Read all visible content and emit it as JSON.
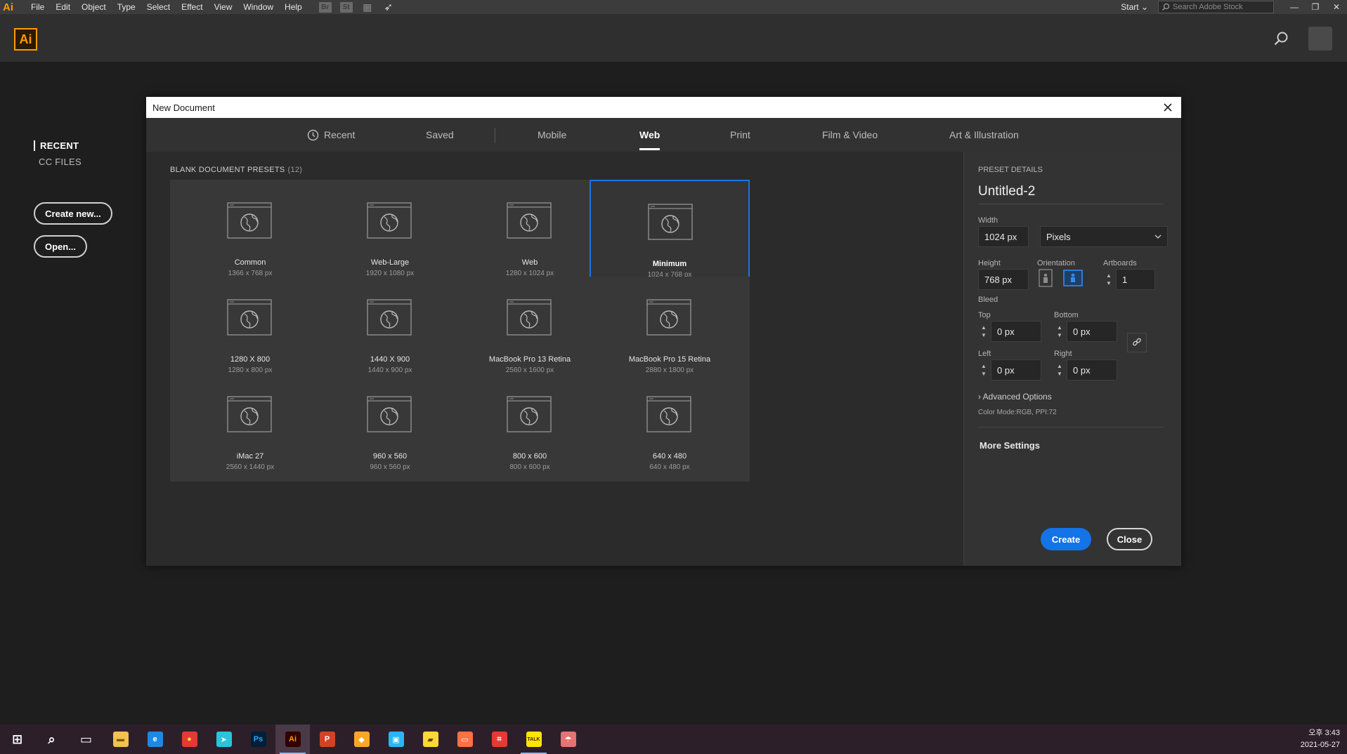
{
  "menubar": {
    "app_mark": "Ai",
    "items": [
      "File",
      "Edit",
      "Object",
      "Type",
      "Select",
      "Effect",
      "View",
      "Window",
      "Help"
    ],
    "toolbar_icons": [
      {
        "name": "bridge-icon",
        "glyph": "Br"
      },
      {
        "name": "stock-icon",
        "glyph": "St"
      },
      {
        "name": "arrange-documents-icon",
        "glyph": "▦"
      },
      {
        "name": "gpu-performance-icon",
        "glyph": "➶"
      }
    ],
    "workspace": "Start",
    "stock_search_placeholder": "Search Adobe Stock"
  },
  "header": {
    "logo": "Ai"
  },
  "start_panel": {
    "nav": [
      "RECENT",
      "CC FILES"
    ],
    "create_button": "Create new...",
    "open_button": "Open..."
  },
  "dialog": {
    "title": "New Document",
    "tabs": [
      "Recent",
      "Saved",
      "Mobile",
      "Web",
      "Print",
      "Film & Video",
      "Art & Illustration"
    ],
    "active_tab": "Web",
    "presets_heading": "BLANK DOCUMENT PRESETS",
    "presets_count": "(12)",
    "presets": [
      {
        "name": "Common",
        "size": "1366 x 768 px"
      },
      {
        "name": "Web-Large",
        "size": "1920 x 1080 px"
      },
      {
        "name": "Web",
        "size": "1280 x 1024 px"
      },
      {
        "name": "Minimum",
        "size": "1024 x 768 px"
      },
      {
        "name": "1280 X 800",
        "size": "1280 x 800 px"
      },
      {
        "name": "1440 X 900",
        "size": "1440 x 900 px"
      },
      {
        "name": "MacBook Pro 13 Retina",
        "size": "2560 x 1600 px"
      },
      {
        "name": "MacBook Pro 15 Retina",
        "size": "2880 x 1800 px"
      },
      {
        "name": "iMac 27",
        "size": "2560 x 1440 px"
      },
      {
        "name": "960 x 560",
        "size": "960 x 560 px"
      },
      {
        "name": "800 x 600",
        "size": "800 x 600 px"
      },
      {
        "name": "640 x 480",
        "size": "640 x 480 px"
      }
    ],
    "selected_preset": "Minimum",
    "details": {
      "heading": "PRESET DETAILS",
      "doc_name": "Untitled-2",
      "width_label": "Width",
      "width_value": "1024 px",
      "units": "Pixels",
      "height_label": "Height",
      "height_value": "768 px",
      "orientation_label": "Orientation",
      "orientation": "landscape",
      "artboards_label": "Artboards",
      "artboards_value": "1",
      "bleed_label": "Bleed",
      "top_label": "Top",
      "top_value": "0 px",
      "bottom_label": "Bottom",
      "bottom_value": "0 px",
      "left_label": "Left",
      "left_value": "0 px",
      "right_label": "Right",
      "right_value": "0 px",
      "advanced": "Advanced Options",
      "color_mode": "Color Mode:RGB, PPI:72",
      "more_settings": "More Settings",
      "create": "Create",
      "close": "Close"
    }
  },
  "taskbar": {
    "apps": [
      {
        "name": "start-button",
        "glyph": "⊞",
        "bg": "",
        "fg": "#ffffff"
      },
      {
        "name": "search-taskbar-icon",
        "glyph": "⌕",
        "bg": "",
        "fg": "#ffffff"
      },
      {
        "name": "task-view-icon",
        "glyph": "▭",
        "bg": "",
        "fg": "#ffffff"
      },
      {
        "name": "file-explorer-icon",
        "glyph": "▬",
        "bg": "#f2c14e",
        "fg": "#7a5a00"
      },
      {
        "name": "edge-icon",
        "glyph": "e",
        "bg": "#1e88e5",
        "fg": "#ffffff"
      },
      {
        "name": "chrome-icon",
        "glyph": "●",
        "bg": "#e53935",
        "fg": "#fdd835"
      },
      {
        "name": "bird-app-icon",
        "glyph": "➤",
        "bg": "#26c6da",
        "fg": "#ffffff"
      },
      {
        "name": "photoshop-icon",
        "glyph": "Ps",
        "bg": "#001e36",
        "fg": "#31a8ff"
      },
      {
        "name": "illustrator-icon",
        "glyph": "Ai",
        "bg": "#330000",
        "fg": "#ff9a00"
      },
      {
        "name": "powerpoint-icon",
        "glyph": "P",
        "bg": "#d04423",
        "fg": "#ffffff"
      },
      {
        "name": "paint-icon",
        "glyph": "◆",
        "bg": "#f9a825",
        "fg": "#ffffff"
      },
      {
        "name": "ticket-app-icon",
        "glyph": "▣",
        "bg": "#29b6f6",
        "fg": "#ffffff"
      },
      {
        "name": "sticky-notes-icon",
        "glyph": "▰",
        "bg": "#fdd835",
        "fg": "#5d4a00"
      },
      {
        "name": "media-player-icon",
        "glyph": "▭",
        "bg": "#ff7043",
        "fg": "#ffffff"
      },
      {
        "name": "snipping-tool-icon",
        "glyph": "⌗",
        "bg": "#e53935",
        "fg": "#ffffff"
      },
      {
        "name": "kakaotalk-icon",
        "glyph": "TALK",
        "bg": "#fee500",
        "fg": "#3c1e1e"
      },
      {
        "name": "weather-app-icon",
        "glyph": "☂",
        "bg": "#e57373",
        "fg": "#ffffff"
      }
    ],
    "time": "오후 3:43",
    "date": "2021-05-27"
  }
}
